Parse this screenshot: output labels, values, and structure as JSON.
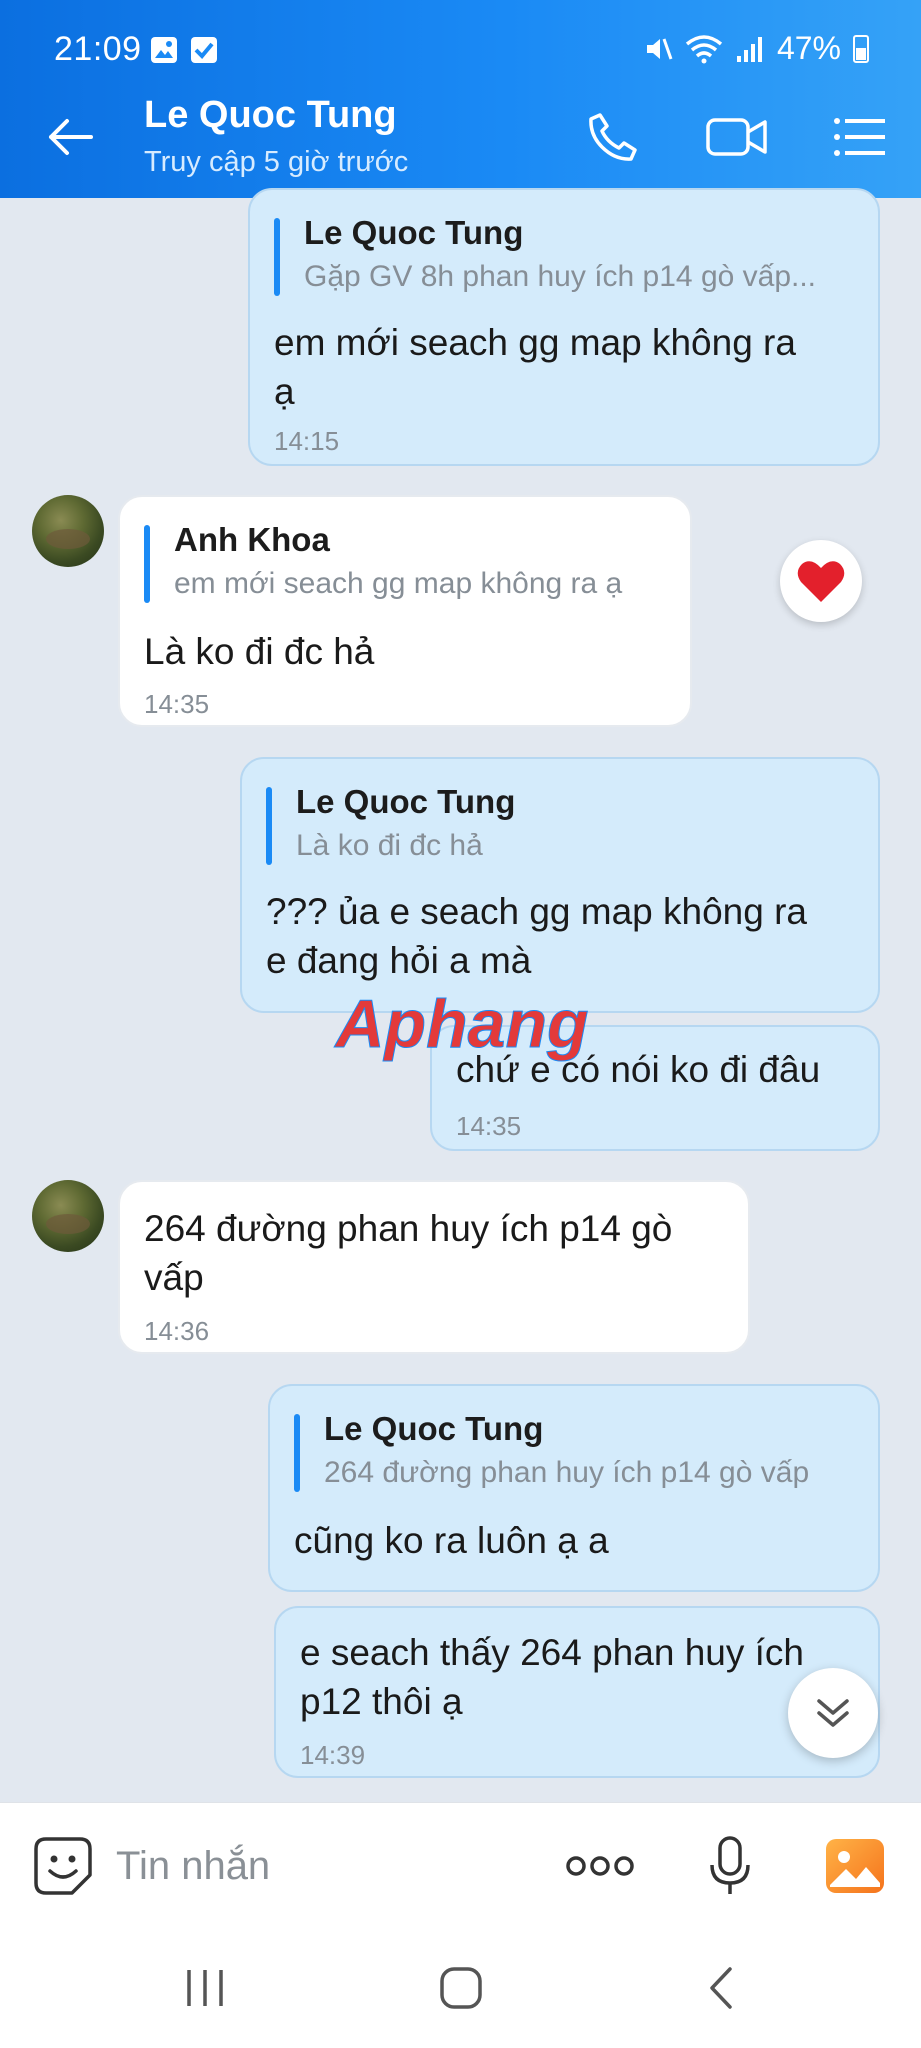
{
  "status_bar": {
    "time": "21:09",
    "battery": "47%"
  },
  "header": {
    "contact_name": "Le Quoc Tung",
    "contact_status": "Truy cập 5 giờ trước",
    "icons": [
      "back-arrow-icon",
      "phone-icon",
      "video-call-icon",
      "menu-list-icon"
    ]
  },
  "messages": [
    {
      "direction": "outgoing",
      "quote": {
        "author": "Le Quoc Tung",
        "text": "Gặp GV 8h phan huy ích p14 gò vấp..."
      },
      "lines": [
        "em mới seach gg map không ra",
        "ạ"
      ],
      "time": "14:15"
    },
    {
      "direction": "incoming",
      "quote": {
        "author": "Anh Khoa",
        "text": "em mới seach gg map không ra ạ"
      },
      "lines": [
        "Là ko đi đc hả"
      ],
      "time": "14:35",
      "reaction": "heart-icon"
    },
    {
      "direction": "outgoing",
      "quote": {
        "author": "Le Quoc Tung",
        "text": "Là ko đi đc hả"
      },
      "lines": [
        "??? ủa e seach gg map không ra",
        "e đang hỏi a mà"
      ]
    },
    {
      "direction": "outgoing",
      "lines": [
        "chứ e có nói ko đi đâu"
      ],
      "time": "14:35"
    },
    {
      "direction": "incoming",
      "lines": [
        "264 đường phan huy ích p14 gò",
        "vấp"
      ],
      "time": "14:36"
    },
    {
      "direction": "outgoing",
      "quote": {
        "author": "Le Quoc Tung",
        "text": "264 đường phan huy ích p14 gò vấp"
      },
      "lines": [
        "cũng ko ra luôn ạ a"
      ]
    },
    {
      "direction": "outgoing",
      "lines": [
        "e seach thấy 264 phan huy ích",
        "p12 thôi ạ"
      ],
      "time": "14:39"
    }
  ],
  "watermark": "Aphang",
  "input_bar": {
    "placeholder": "Tin nhắn"
  },
  "colors": {
    "header_gradient_start": "#0b6fe0",
    "header_gradient_end": "#35a2f7",
    "outgoing_bubble": "#d4ebfb",
    "incoming_bubble": "#ffffff",
    "chat_background": "#e2e8f0",
    "quote_bar": "#1a8af5"
  }
}
